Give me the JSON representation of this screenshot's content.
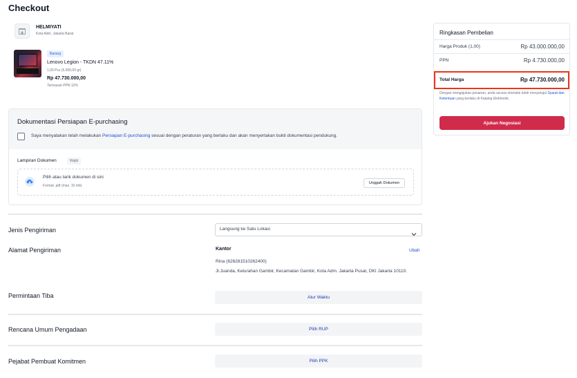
{
  "page": {
    "title": "Checkout"
  },
  "seller": {
    "name": "HELMIYATI",
    "location": "Kota Adm. Jakarta Barat"
  },
  "product": {
    "badge": "Barang",
    "name": "Lenovo Legion - TKDN 47.11%",
    "qty": "1,00 Pcs (5.000,00 gr)",
    "price": "Rp 47.730.000,00",
    "tax_note": "Termasuk PPN 12%"
  },
  "epurchasing": {
    "title": "Dokumentasi Persiapan E-purchasing",
    "consent_pre": "Saya menyatakan telah melakukan ",
    "consent_link": "Persiapan E-purchasing",
    "consent_post": " sesuai dengan peraturan yang berlaku dan akan menyertakan bukti dokumentasi pendukung.",
    "attachment_label": "Lampiran Dokumen",
    "required_badge": "Wajib",
    "dropzone_text": "Pilih atau tarik dokumen di sini",
    "dropzone_hint": "Format .pdf (max. 10 mb)",
    "upload_button": "Unggah Dokumen"
  },
  "shipping": {
    "type_label": "Jenis Pengiriman",
    "type_value": "Langsung ke Satu Lokasi",
    "address_label": "Alamat Pengiriman",
    "address_name": "Kantor",
    "edit_link": "Ubah",
    "phone": "Rina (626281510262400)",
    "address_line": "Jl.Juanda, Kelurahan Gambir, Kecamatan Gambir, Kota Adm. Jakarta Pusat, DKI Jakarta 10110.",
    "arrival_label": "Permintaan Tiba",
    "arrival_button": "Atur Waktu"
  },
  "procurement": {
    "rup_label": "Rencana Umum Pengadaan",
    "rup_button": "Pilih RUP",
    "ppk_label": "Pejabat Pembuat Komitmen",
    "ppk_button": "Pilih PPK"
  },
  "summary": {
    "title": "Ringkasan Pembelian",
    "product_price_label": "Harga Produk (1,00)",
    "product_price_value": "Rp 43.000.000,00",
    "ppn_label": "PPN",
    "ppn_value": "Rp 4.730.000,00",
    "total_label": "Total Harga",
    "total_value": "Rp 47.730.000,00",
    "note_pre": "Dengan mengajukan pesanan, anda secara otomatis telah menyetujui ",
    "note_link": "Syarat dan Ketentuan",
    "note_post": " yang berlaku di Katalog Elektronik.",
    "negotiate_button": "Ajukan Negosiasi"
  },
  "colors": {
    "primary_button": "#d12b4c",
    "link": "#1d4ed8",
    "highlight_border": "#e8351a"
  }
}
